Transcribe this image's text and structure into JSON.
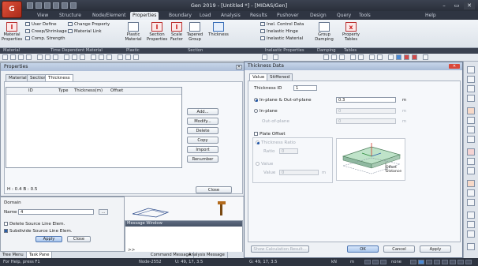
{
  "app": {
    "title": "Gen 2019 - [Untitled *] - [MIDAS/Gen]",
    "logo_text": "G",
    "help_label": "Help"
  },
  "ribbon_tabs": [
    "View",
    "Structure",
    "Node/Element",
    "Properties",
    "Boundary",
    "Load",
    "Analysis",
    "Results",
    "Pushover",
    "Design",
    "Query",
    "Tools"
  ],
  "ribbon": {
    "material_label": "Material\nProperties",
    "user_define": "User Define",
    "creep_shrinkage": "Creep/Shrinkage",
    "comp_strength": "Comp. Strength",
    "change_property": "Change Property",
    "material_link": "Material Link",
    "plastic_material": "Plastic\nMaterial",
    "section_properties": "Section\nProperties",
    "scale_factor": "Scale\nFactor",
    "tapered_group": "Tapered\nGroup",
    "thickness": "Thickness",
    "inel_control": "Inel. Control Data",
    "inelastic_hinge": "Inelastic Hinge",
    "inelastic_material": "Inelastic Material",
    "group_damping": "Group\nDamping",
    "property_tables": "Property\nTables",
    "groups": [
      "Material",
      "Time Dependent Material",
      "Plastic",
      "Section",
      "Inelastic Properties",
      "Damping",
      "Tables"
    ]
  },
  "properties_dialog": {
    "title": "Properties",
    "tabs": [
      "Material",
      "Section",
      "Thickness"
    ],
    "active_tab": "Thickness",
    "columns": [
      "ID",
      "Type",
      "Thickness(m)",
      "Offset"
    ],
    "buttons": [
      "Add...",
      "Modify...",
      "Delete",
      "Copy",
      "Import",
      "Renumber"
    ],
    "footer_text": "H : 0.4  B : 0.5",
    "close_label": "Close"
  },
  "task_pane": {
    "domain_label": "Domain",
    "name_label": "Name",
    "name_value": "4",
    "dots_label": "...",
    "delete_source": "Delete Source Line Elem.",
    "subdivide_source": "Subdivide Source Line Elem.",
    "subdivide_checked": true,
    "apply_label": "Apply",
    "close_label": "Close",
    "tabs": [
      "Tree Menu",
      "Task Pane"
    ]
  },
  "message_window": {
    "title": "Message Window",
    "prompt": ">>",
    "tabs": [
      "Command Message",
      "Analysis Message"
    ]
  },
  "thickness_dialog": {
    "title": "Thickness Data",
    "tabs": [
      "Value",
      "Stiffened"
    ],
    "active_tab": "Value",
    "thickness_id_label": "Thickness ID",
    "thickness_id_value": "1",
    "inplane_outplane_label": "In-plane & Out-of-plane",
    "inplane_outplane_value": "0.3",
    "inplane_label": "In-plane",
    "inplane_value": "0",
    "outplane_label": "Out-of-plane",
    "outplane_value": "0",
    "unit": "m",
    "plate_offset_label": "Plate Offset",
    "thickness_ratio_label": "Thickness Ratio",
    "ratio_sublabel": "Ratio",
    "ratio_value": "0",
    "value_label": "Value",
    "value_sublabel": "Value",
    "value_value": "0",
    "offset_distance_label": "Offset\nDistance",
    "show_calc_label": "Show Calculation Result...",
    "ok_label": "OK",
    "cancel_label": "Cancel",
    "apply_label": "Apply"
  },
  "status_bar": {
    "help_text": "For Help, press F1",
    "node": "Node-2552",
    "u_coord": "U: 49, 17, 3.5",
    "g_coord": "G: 49, 17, 3.5",
    "unit_kn": "kN",
    "unit_m": "m",
    "none": "none"
  },
  "colors": {
    "ribbon_dark": "#2f3542",
    "accent_blue": "#1f56a8",
    "close_red": "#d9483b"
  }
}
